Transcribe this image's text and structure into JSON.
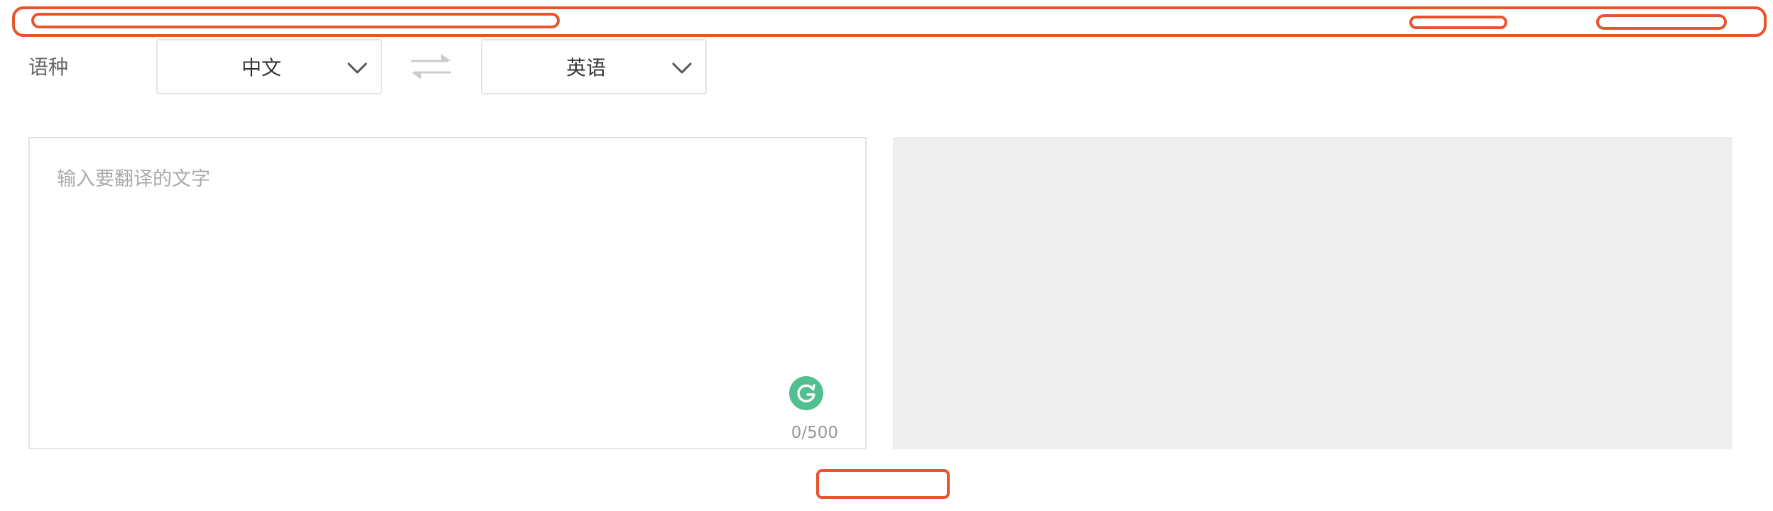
{
  "language_bar": {
    "label": "语种",
    "source_language": "中文",
    "target_language": "英语"
  },
  "input": {
    "placeholder": "输入要翻译的文字",
    "value": "",
    "char_count": "0/500"
  },
  "output": {
    "text": ""
  },
  "colors": {
    "highlight": "#e8542c",
    "grammar_icon": "#52bf90",
    "output_background": "#eeeeee"
  },
  "icons": {
    "swap": "swap-arrows-icon",
    "dropdown": "chevron-down-icon",
    "grammar": "grammarly-g-icon"
  }
}
